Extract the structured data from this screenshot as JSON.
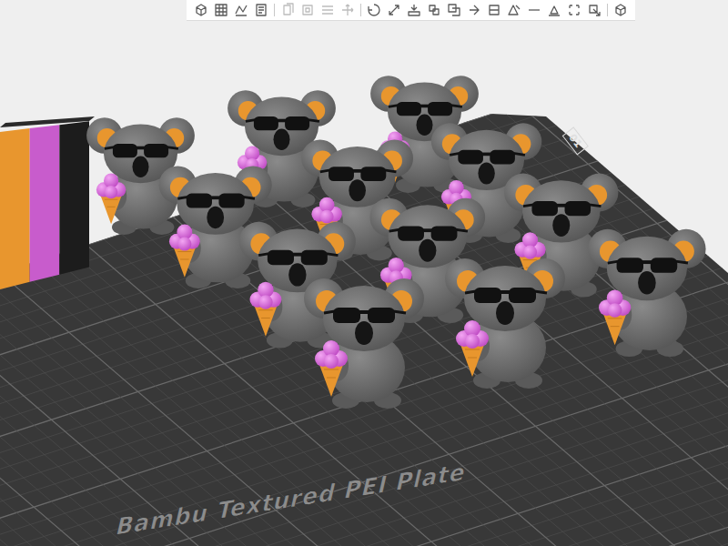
{
  "toolbar": {
    "groups": [
      {
        "items": [
          {
            "disabled": false
          },
          {
            "disabled": false
          },
          {
            "disabled": false
          },
          {
            "disabled": false
          }
        ]
      },
      {
        "items": [
          {
            "disabled": true
          },
          {
            "disabled": true
          },
          {
            "disabled": true
          },
          {
            "disabled": true
          }
        ]
      },
      {
        "items": [
          {
            "disabled": false
          },
          {
            "disabled": false
          },
          {
            "disabled": false
          },
          {
            "disabled": false
          },
          {
            "disabled": false
          },
          {
            "disabled": false
          },
          {
            "disabled": false
          },
          {
            "disabled": false
          },
          {
            "disabled": false
          },
          {
            "disabled": false
          },
          {
            "disabled": false
          },
          {
            "disabled": false
          }
        ]
      },
      {
        "items": [
          {
            "disabled": false
          }
        ]
      }
    ]
  },
  "plate": {
    "label": "Bambu Textured PEI Plate",
    "index": "01"
  },
  "wipe_tower": {
    "filaments": [
      {
        "color": "#e8962e"
      },
      {
        "color": "#c85ccc"
      },
      {
        "color": "#1c1c1c"
      }
    ]
  }
}
